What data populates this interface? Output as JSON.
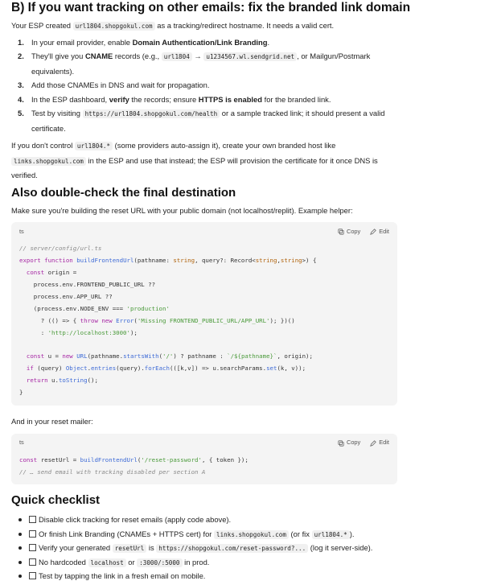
{
  "section_b": {
    "heading": "B) If you want tracking on other emails: fix the branded link domain",
    "intro_pre": "Your ESP created ",
    "intro_code": "url1804.shopgokul.com",
    "intro_post": " as a tracking/redirect hostname. It needs a valid cert.",
    "steps": [
      {
        "num": "1.",
        "pre": "In your email provider, enable ",
        "bold": "Domain Authentication/Link Branding",
        "post": "."
      },
      {
        "num": "2.",
        "pre": "They'll give you ",
        "bold": "CNAME",
        "mid": " records (e.g., ",
        "code1": "url1804",
        "arrow": " → ",
        "code2": "u1234567.wl.sendgrid.net",
        "post": ", or Mailgun/Postmark",
        "cont": "equivalents)."
      },
      {
        "num": "3.",
        "text": "Add those CNAMEs in DNS and wait for propagation."
      },
      {
        "num": "4.",
        "pre": "In the ESP dashboard, ",
        "bold": "verify",
        "mid": " the records; ensure ",
        "bold2": "HTTPS is enabled",
        "post": " for the branded link."
      },
      {
        "num": "5.",
        "pre": "Test by visiting ",
        "code": "https://url1804.shopgokul.com/health",
        "post": " or a sample tracked link; it should present a valid",
        "cont": "certificate."
      }
    ],
    "note_pre": "If you don't control ",
    "note_code1": "url1804.*",
    "note_mid": " (some providers auto-assign it), create your own branded host like",
    "note_code2": "links.shopgokul.com",
    "note_post": " in the ESP and use that instead; the ESP will provision the certificate for it once DNS is",
    "note_end": "verified."
  },
  "section_dest": {
    "heading": "Also double-check the final destination",
    "intro": "Make sure you're building the reset URL with your public domain (not localhost/replit). Example helper:"
  },
  "code_block_1": {
    "lang": "ts",
    "copy_label": "Copy",
    "edit_label": "Edit"
  },
  "mailer_intro": "And in your reset mailer:",
  "code_block_2": {
    "lang": "ts",
    "copy_label": "Copy",
    "edit_label": "Edit"
  },
  "checklist": {
    "heading": "Quick checklist",
    "items": [
      {
        "text": "Disable click tracking for reset emails (apply code above)."
      },
      {
        "pre": "Or finish Link Branding (CNAMEs + HTTPS cert) for ",
        "code": "links.shopgokul.com",
        "mid": " (or fix ",
        "code2": "url1804.*",
        "post": ")."
      },
      {
        "pre": "Verify your generated ",
        "code": "resetUrl",
        "mid": " is ",
        "code2": "https://shopgokul.com/reset-password?...",
        "post": " (log it server-side)."
      },
      {
        "pre": "No hardcoded ",
        "code": "localhost",
        "mid": " or ",
        "code2": ":3000/:5000",
        "post": " in prod."
      },
      {
        "text": "Test by tapping the link in a fresh email on mobile."
      }
    ]
  }
}
